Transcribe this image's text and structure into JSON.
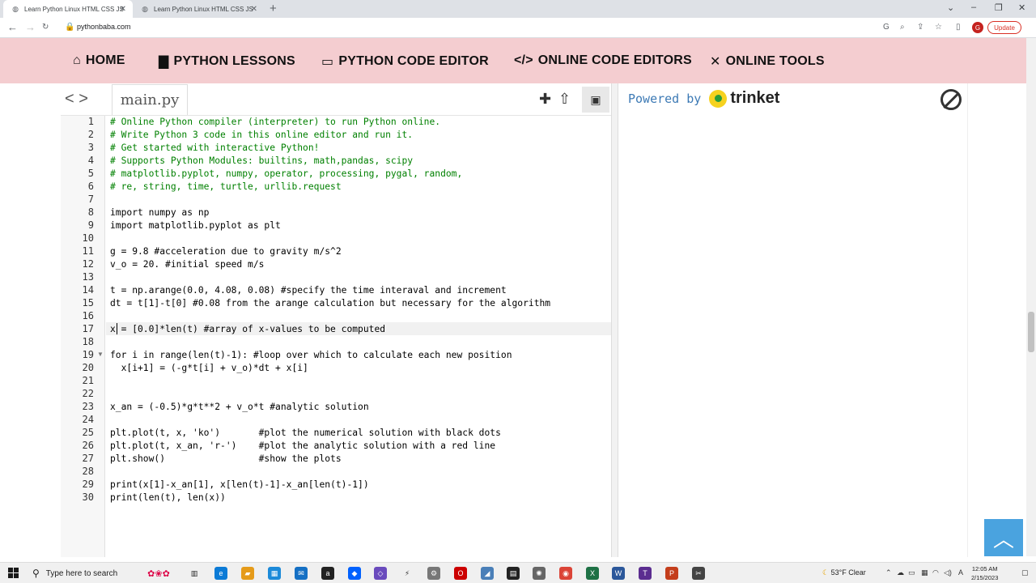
{
  "browser": {
    "tabs": [
      {
        "title": "Learn Python Linux HTML CSS JS"
      },
      {
        "title": "Learn Python Linux HTML CSS JS"
      }
    ],
    "url": "pythonbaba.com",
    "update_label": "Update",
    "profile_initial": "G"
  },
  "site_nav": {
    "items": [
      {
        "label": "HOME",
        "icon": "home-icon"
      },
      {
        "label": "PYTHON LESSONS",
        "icon": "book-icon"
      },
      {
        "label": "PYTHON CODE EDITOR",
        "icon": "monitor-icon"
      },
      {
        "label": "ONLINE CODE EDITORS",
        "icon": "code-icon"
      },
      {
        "label": "ONLINE TOOLS",
        "icon": "tools-icon"
      }
    ]
  },
  "editor": {
    "file_tab": "main.py",
    "lines": [
      "# Online Python compiler (interpreter) to run Python online.",
      "# Write Python 3 code in this online editor and run it.",
      "# Get started with interactive Python!",
      "# Supports Python Modules: builtins, math,pandas, scipy",
      "# matplotlib.pyplot, numpy, operator, processing, pygal, random,",
      "# re, string, time, turtle, urllib.request",
      "",
      "import numpy as np",
      "import matplotlib.pyplot as plt",
      "",
      "g = 9.8 #acceleration due to gravity m/s^2",
      "v_o = 20. #initial speed m/s",
      "",
      "t = np.arange(0.0, 4.08, 0.08) #specify the time interaval and increment",
      "dt = t[1]-t[0] #0.08 from the arange calculation but necessary for the algorithm",
      "",
      "x = [0.0]*len(t) #array of x-values to be computed",
      "",
      "for i in range(len(t)-1): #loop over which to calculate each new position",
      "  x[i+1] = (-g*t[i] + v_o)*dt + x[i]",
      "",
      "",
      "x_an = (-0.5)*g*t**2 + v_o*t #analytic solution",
      "",
      "plt.plot(t, x, 'ko')       #plot the numerical solution with black dots",
      "plt.plot(t, x_an, 'r-')    #plot the analytic solution with a red line",
      "plt.show()                 #show the plots",
      "",
      "print(x[1]-x_an[1], x[len(t)-1]-x_an[len(t)-1])",
      "print(len(t), len(x))"
    ],
    "line_numbers": [
      "1",
      "2",
      "3",
      "4",
      "5",
      "6",
      "7",
      "8",
      "9",
      "10",
      "11",
      "12",
      "13",
      "14",
      "15",
      "16",
      "17",
      "18",
      "19",
      "20",
      "21",
      "22",
      "23",
      "24",
      "25",
      "26",
      "27",
      "28",
      "29",
      "30"
    ]
  },
  "output": {
    "powered_by": "Powered by",
    "brand": "trinket"
  },
  "taskbar": {
    "search_placeholder": "Type here to search",
    "weather": "53°F  Clear",
    "time": "12:05 AM",
    "date": "2/15/2023"
  }
}
